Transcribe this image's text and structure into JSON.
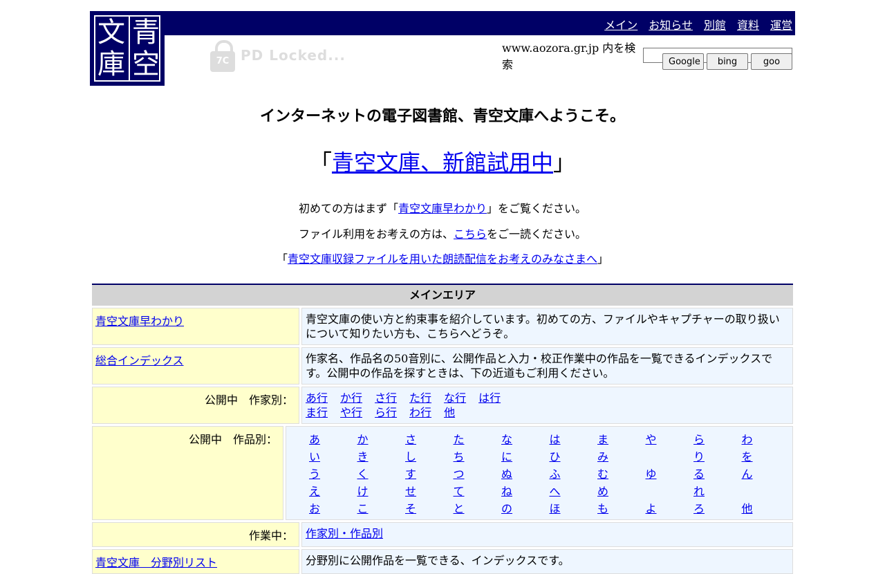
{
  "logo": {
    "chars": [
      "青",
      "文",
      "空",
      "庫"
    ]
  },
  "nav": {
    "items": [
      "メイン",
      "お知らせ",
      "別館",
      "資料",
      "運営"
    ]
  },
  "watermark": {
    "badge": "7C",
    "text": "PD Locked..."
  },
  "search": {
    "label": "www.aozora.gr.jp 内を検索",
    "value": "",
    "buttons": [
      "Google",
      "bing",
      "goo"
    ]
  },
  "welcome": "インターネットの電子図書館、青空文庫へようこそ。",
  "newhall": {
    "open": "「",
    "link": "青空文庫、新館試用中",
    "close": "」"
  },
  "intro": {
    "line1_pre": "初めての方はまず「",
    "line1_link": "青空文庫早わかり",
    "line1_post": "」をご覧ください。",
    "line2_pre": "ファイル利用をお考えの方は、",
    "line2_link": "こちら",
    "line2_post": "をご一読ください。",
    "line3_pre": "「",
    "line3_link": "青空文庫収録ファイルを用いた朗読配信をお考えのみなさまへ",
    "line3_post": "」"
  },
  "main": {
    "title": "メインエリア",
    "rows": [
      {
        "left": "青空文庫早わかり",
        "right": "青空文庫の使い方と約束事を紹介しています。初めての方、ファイルやキャプチャーの取り扱いについて知りたい方も、こちらへどうぞ。"
      },
      {
        "left": "総合インデックス",
        "right": "作家名、作品名の50音別に、公開作品と入力・校正作業中の作品を一覧できるインデックスです。公開中の作品を探すときは、下の近道もご利用ください。"
      }
    ],
    "author_label": "公開中　作家別：",
    "author_links": [
      "あ行",
      "か行",
      "さ行",
      "た行",
      "な行",
      "は行",
      "ま行",
      "や行",
      "ら行",
      "わ行",
      "他"
    ],
    "works_label": "公開中　作品別：",
    "works_grid": [
      [
        "あ",
        "か",
        "さ",
        "た",
        "な",
        "は",
        "ま",
        "や",
        "ら",
        "わ"
      ],
      [
        "い",
        "き",
        "し",
        "ち",
        "に",
        "ひ",
        "み",
        "",
        "り",
        "を"
      ],
      [
        "う",
        "く",
        "す",
        "つ",
        "ぬ",
        "ふ",
        "む",
        "ゆ",
        "る",
        "ん"
      ],
      [
        "え",
        "け",
        "せ",
        "て",
        "ね",
        "へ",
        "め",
        "",
        "れ",
        ""
      ],
      [
        "お",
        "こ",
        "そ",
        "と",
        "の",
        "ほ",
        "も",
        "よ",
        "ろ",
        "他"
      ]
    ],
    "inprogress_label": "作業中：",
    "inprogress_link": "作家別・作品別",
    "last_row": {
      "left": "青空文庫　分野別リスト",
      "right": "分野別に公開作品を一覧できる、インデックスです。"
    }
  }
}
